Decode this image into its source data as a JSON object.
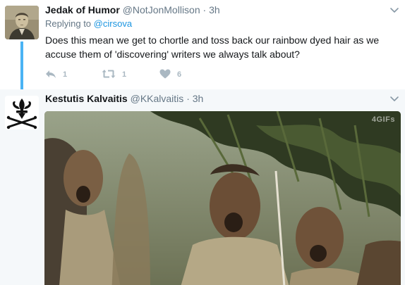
{
  "tweets": [
    {
      "author_name": "Jedak of Humor",
      "author_handle": "@NotJonMollison",
      "separator": "·",
      "time": "3h",
      "reply_prefix": "Replying to",
      "reply_to": "@cirsova",
      "text": "Does this mean we get to chortle and toss back our rainbow dyed hair as we accuse them of 'discovering' writers we always talk about?",
      "reply_count": "1",
      "retweet_count": "1",
      "like_count": "6",
      "avatar_icon": "portrait-photo"
    },
    {
      "author_name": "Kestutis Kalvaitis",
      "author_handle": "@KKalvaitis",
      "separator": "·",
      "time": "3h",
      "avatar_icon": "fleur-de-lis-skull-crossbones-icon",
      "media_watermark": "4GIFs"
    }
  ],
  "colors": {
    "link_blue": "#1b95e0",
    "thread_line": "#4ab3f4",
    "muted": "#657786",
    "action_gray": "#aab8c2",
    "selected_bg": "#f5f8fa"
  },
  "icons": {
    "caret": "chevron-down-icon",
    "reply": "reply-icon",
    "retweet": "retweet-icon",
    "like": "heart-icon"
  }
}
